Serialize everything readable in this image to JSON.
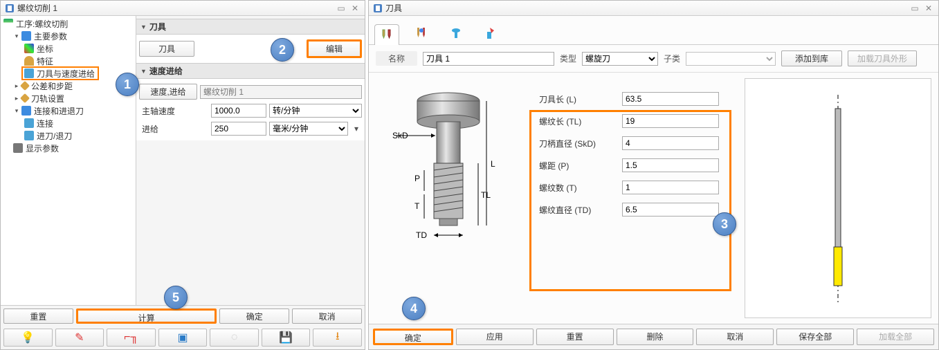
{
  "left": {
    "title": "螺纹切削 1",
    "tree": {
      "root": "工序:螺纹切削",
      "main_params": "主要参数",
      "coord": "坐标",
      "feature": "特征",
      "tool_speed_feed": "刀具与速度进给",
      "tol_step": "公差和步距",
      "toolpath_setup": "刀轨设置",
      "connect_inout": "连接和进退刀",
      "connect": "连接",
      "in_out": "进刀/退刀",
      "display_params": "显示参数"
    },
    "sections": {
      "tool_header": "刀具",
      "tool_btn": "刀具",
      "edit_btn": "编辑",
      "speedfeed_header": "速度进给",
      "speedfeed_btn": "速度,进给",
      "speedfeed_value": "螺纹切削 1",
      "spindle_label": "主轴速度",
      "spindle_value": "1000.0",
      "spindle_unit": "转/分钟",
      "feed_label": "进给",
      "feed_value": "250",
      "feed_unit": "毫米/分钟"
    },
    "footer": {
      "reset": "重置",
      "calc": "计算",
      "ok": "确定",
      "cancel": "取消"
    }
  },
  "right": {
    "title": "刀具",
    "toprow": {
      "name_label": "名称",
      "name_value": "刀具 1",
      "type_label": "类型",
      "type_value": "螺旋刀",
      "subtype_label": "子类",
      "subtype_value": "",
      "add_lib": "添加到库",
      "load_shape": "加载刀具外形"
    },
    "params": {
      "L_label": "刀具长 (L)",
      "L_value": "63.5",
      "TL_label": "螺纹长 (TL)",
      "TL_value": "19",
      "SkD_label": "刀柄直径 (SkD)",
      "SkD_value": "4",
      "P_label": "螺距 (P)",
      "P_value": "1.5",
      "T_label": "螺纹数 (T)",
      "T_value": "1",
      "TD_label": "螺纹直径 (TD)",
      "TD_value": "6.5"
    },
    "diagram_labels": {
      "SkD": "SkD",
      "L": "L",
      "TL": "TL",
      "P": "P",
      "T": "T",
      "TD": "TD"
    },
    "footer": {
      "ok": "确定",
      "apply": "应用",
      "reset": "重置",
      "delete": "删除",
      "cancel": "取消",
      "save_all": "保存全部",
      "load_all": "加载全部"
    }
  },
  "bubbles": {
    "1": "1",
    "2": "2",
    "3": "3",
    "4": "4",
    "5": "5"
  }
}
